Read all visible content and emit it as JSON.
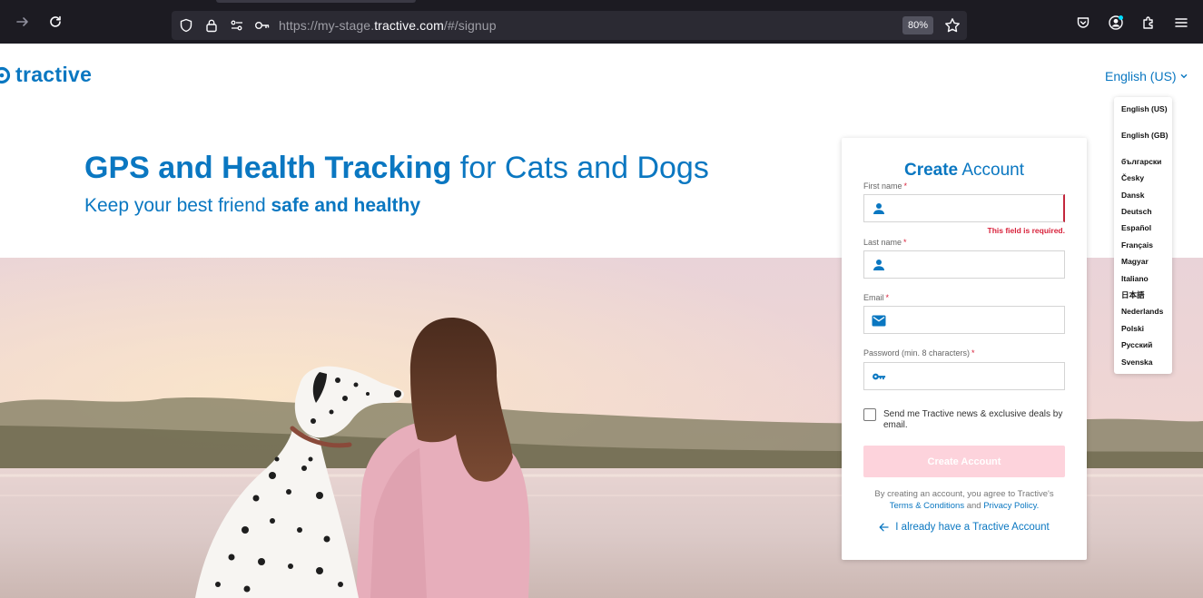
{
  "browser": {
    "url_prefix": "https://my-stage.",
    "url_domain": "tractive.com",
    "url_suffix": "/#/signup",
    "zoom": "80%"
  },
  "header": {
    "logo_text": "tractive",
    "language_button": "English (US)"
  },
  "hero": {
    "headline_bold": "GPS and Health Tracking",
    "headline_rest": "for Cats and Dogs",
    "subline_regular": "Keep your best friend",
    "subline_bold": "safe and healthy"
  },
  "signup": {
    "title_bold": "Create",
    "title_rest": "Account",
    "required_mark": "*",
    "fields": [
      {
        "label": "First name",
        "icon": "person-icon",
        "error": "This field is required."
      },
      {
        "label": "Last name",
        "icon": "person-icon"
      },
      {
        "label": "Email",
        "icon": "mail-icon"
      },
      {
        "label": "Password (min. 8 characters)",
        "icon": "key-icon"
      }
    ],
    "newsletter_label": "Send me Tractive news & exclusive deals by email.",
    "submit_label": "Create Account",
    "terms_prefix": "By creating an account, you agree to Tractive's",
    "terms_link": "Terms & Conditions",
    "terms_and": "and",
    "privacy_link": "Privacy Policy.",
    "login_link": "I already have a Tractive Account"
  },
  "language_menu": {
    "items": [
      "English (US)",
      "English (GB)",
      "български",
      "Česky",
      "Dansk",
      "Deutsch",
      "Español",
      "Français",
      "Magyar",
      "Italiano",
      "日本語",
      "Nederlands",
      "Polski",
      "Русский",
      "Svenska"
    ]
  },
  "colors": {
    "brand_blue": "#0a77c1",
    "error_red": "#d8223b",
    "button_disabled_pink": "#fdd3dc"
  }
}
